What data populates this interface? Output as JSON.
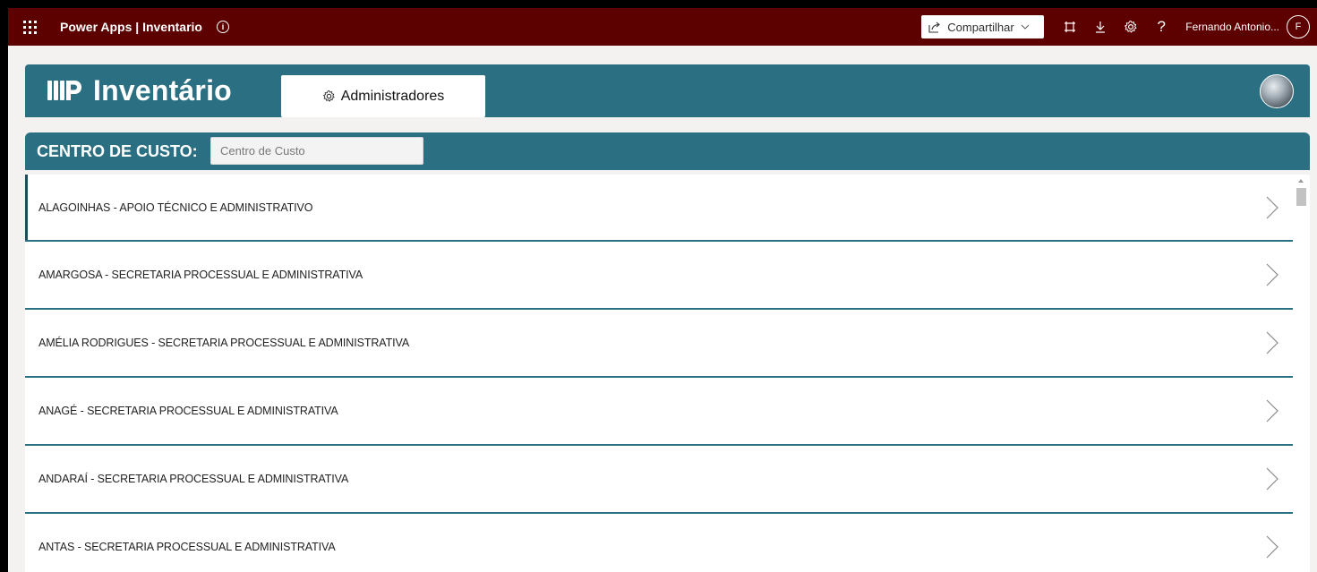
{
  "suitebar": {
    "app_title": "Power Apps | Inventario",
    "share_label": "Compartilhar",
    "user_name": "Fernando Antonio...",
    "user_initial": "F",
    "background_color": "#5c0000"
  },
  "header": {
    "app_name": "Inventário",
    "admin_button_label": "Administradores",
    "accent_color": "#2a7082"
  },
  "filter": {
    "label": "CENTRO DE CUSTO:",
    "placeholder": "Centro de Custo",
    "value": ""
  },
  "list": {
    "items": [
      {
        "label": "ALAGOINHAS - APOIO TÉCNICO E ADMINISTRATIVO"
      },
      {
        "label": "AMARGOSA - SECRETARIA PROCESSUAL E ADMINISTRATIVA"
      },
      {
        "label": "AMÉLIA RODRIGUES - SECRETARIA PROCESSUAL E ADMINISTRATIVA"
      },
      {
        "label": "ANAGÉ - SECRETARIA PROCESSUAL E ADMINISTRATIVA"
      },
      {
        "label": "ANDARAÍ - SECRETARIA PROCESSUAL E ADMINISTRATIVA"
      },
      {
        "label": "ANTAS - SECRETARIA PROCESSUAL E ADMINISTRATIVA"
      }
    ],
    "selected_index": 0
  },
  "icons": {
    "waffle": "app-launcher-icon",
    "info": "info-icon",
    "share": "share-icon",
    "fit": "fit-to-window-icon",
    "download": "download-icon",
    "settings": "settings-gear-icon",
    "help": "help-icon",
    "chevron": "chevron-right-icon"
  }
}
